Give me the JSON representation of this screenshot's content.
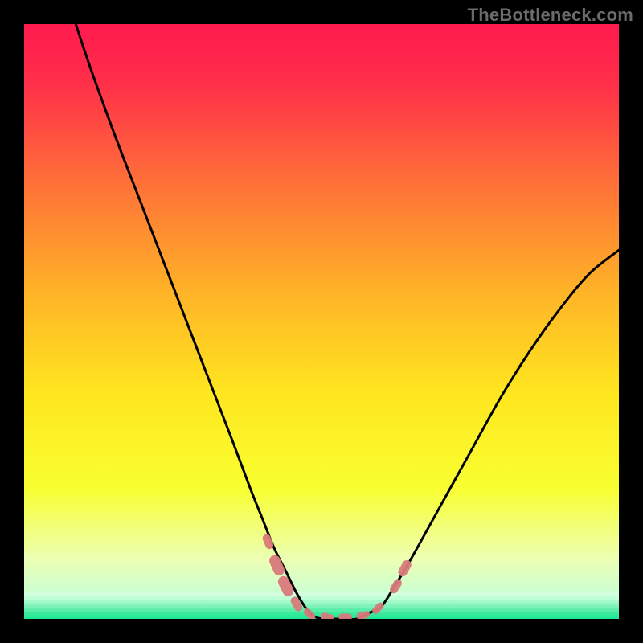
{
  "watermark": "TheBottleneck.com",
  "chart_data": {
    "type": "line",
    "title": "",
    "xlabel": "",
    "ylabel": "",
    "xlim": [
      0,
      100
    ],
    "ylim": [
      0,
      100
    ],
    "note": "Axes are unlabeled. Values are normalized 0-100 estimates read from pixel positions. y represents the height of the black curve above the chart floor (higher = worse / closer to red). The curve is a V shape dipping to ~0 around x≈48-60 with a flat green floor band.",
    "series": [
      {
        "name": "bottleneck-curve",
        "x": [
          0,
          5,
          10,
          15,
          20,
          25,
          30,
          35,
          38,
          40,
          42,
          44,
          46,
          48,
          50,
          52,
          54,
          56,
          58,
          60,
          62,
          65,
          70,
          75,
          80,
          85,
          90,
          95,
          100
        ],
        "y": [
          130,
          112,
          96,
          82,
          69,
          56,
          43,
          30,
          22,
          17,
          12,
          8,
          4,
          1,
          0,
          0,
          0,
          0,
          1,
          2,
          5,
          10,
          19,
          28,
          37,
          45,
          52,
          58,
          62
        ]
      }
    ],
    "markers": {
      "name": "highlight-dots",
      "color": "#d87a7a",
      "points": [
        {
          "x": 41.0,
          "y": 13.0,
          "r": 1.6
        },
        {
          "x": 42.5,
          "y": 9.0,
          "r": 2.2
        },
        {
          "x": 44.0,
          "y": 5.5,
          "r": 2.2
        },
        {
          "x": 45.8,
          "y": 2.5,
          "r": 1.6
        },
        {
          "x": 48.0,
          "y": 0.8,
          "r": 1.4
        },
        {
          "x": 51.0,
          "y": 0.3,
          "r": 1.4
        },
        {
          "x": 54.0,
          "y": 0.3,
          "r": 1.4
        },
        {
          "x": 57.0,
          "y": 0.6,
          "r": 1.4
        },
        {
          "x": 59.5,
          "y": 1.8,
          "r": 1.4
        },
        {
          "x": 62.5,
          "y": 5.5,
          "r": 1.6
        },
        {
          "x": 64.0,
          "y": 8.5,
          "r": 1.8
        }
      ]
    },
    "background_gradient": {
      "stops": [
        {
          "pos": 0.0,
          "color": "#ff1a4e"
        },
        {
          "pos": 0.1,
          "color": "#ff2f49"
        },
        {
          "pos": 0.25,
          "color": "#ff6a3a"
        },
        {
          "pos": 0.45,
          "color": "#ffb327"
        },
        {
          "pos": 0.62,
          "color": "#ffe61f"
        },
        {
          "pos": 0.78,
          "color": "#f8ff30"
        },
        {
          "pos": 0.9,
          "color": "#ecffb4"
        },
        {
          "pos": 0.965,
          "color": "#c6ffd6"
        },
        {
          "pos": 1.0,
          "color": "#17e893"
        }
      ]
    }
  }
}
